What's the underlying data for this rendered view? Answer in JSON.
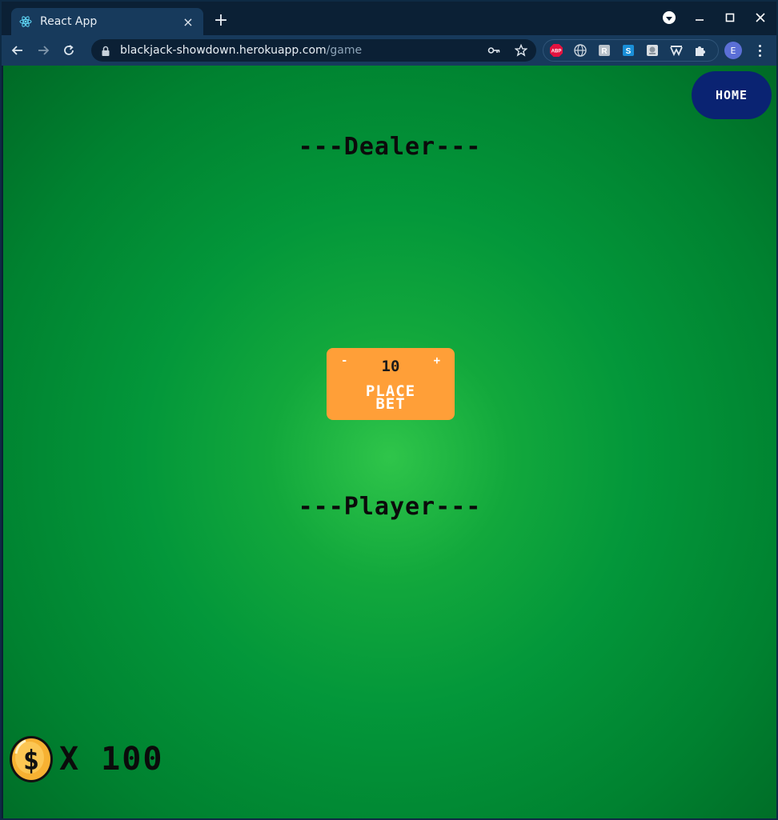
{
  "browser": {
    "tab_title": "React App",
    "tab_close": "×",
    "new_tab": "+",
    "url_host": "blackjack-showdown.herokuapp.com",
    "url_path": "/game",
    "profile_initial": "E"
  },
  "game": {
    "home_label": "HOME",
    "dealer_label": "---Dealer---",
    "player_label": "---Player---",
    "bet": {
      "minus": "-",
      "plus": "+",
      "amount": "10",
      "place_line1": "PLACE",
      "place_line2": "BET"
    },
    "coins": {
      "count_text": "X 100",
      "symbol": "$"
    }
  },
  "colors": {
    "felt_center": "#2fc54a",
    "felt_edge": "#006a26",
    "bet_panel": "#ff9f38",
    "home_button": "#0a2372",
    "coin": "#f7b132"
  }
}
